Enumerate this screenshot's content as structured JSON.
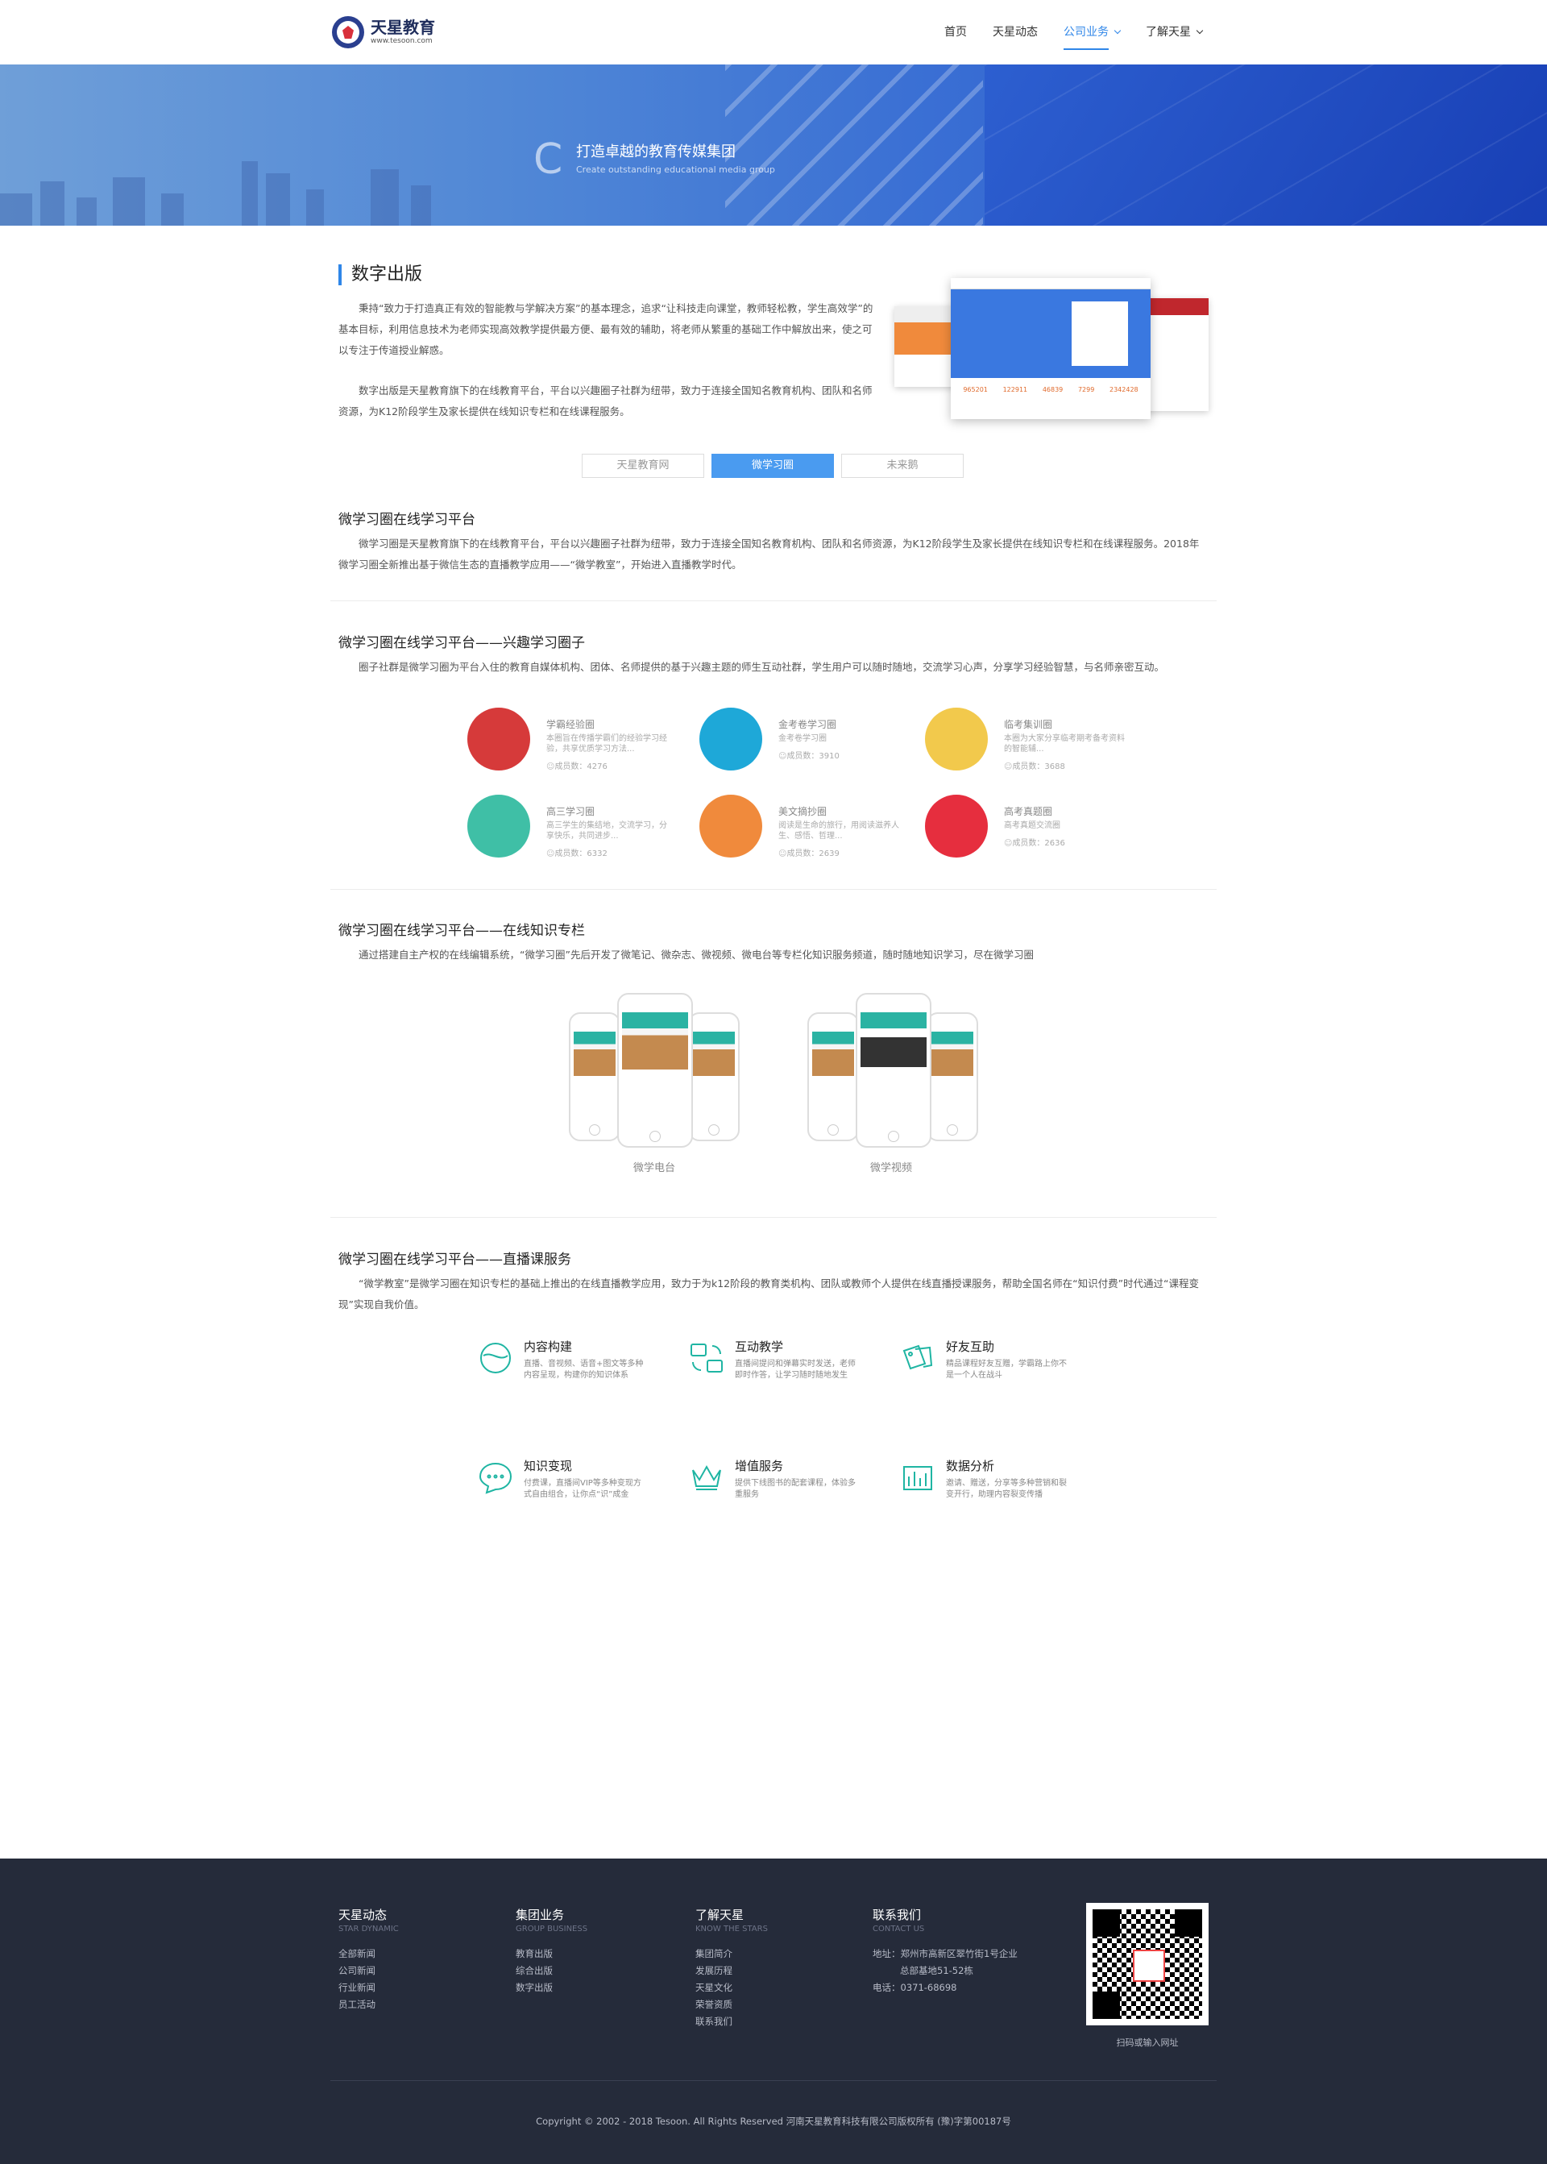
{
  "header": {
    "logo_title": "天星教育",
    "logo_url": "www.tesoon.com",
    "nav": [
      {
        "label": "首页"
      },
      {
        "label": "天星动态"
      },
      {
        "label": "公司业务"
      },
      {
        "label": "了解天星"
      }
    ]
  },
  "banner": {
    "letter": "C",
    "title": "打造卓越的教育传媒集团",
    "subtitle": "Create outstanding educational media group"
  },
  "intro": {
    "heading": "数字出版",
    "para1": "秉持“致力于打造真正有效的智能教与学解决方案”的基本理念，追求“让科技走向课堂，教师轻松教，学生高效学”的基本目标，利用信息技术为老师实现高效教学提供最方便、最有效的辅助，将老师从繁重的基础工作中解放出来，使之可以专注于传道授业解惑。",
    "para2": "数字出版是天星教育旗下的在线教育平台，平台以兴趣圈子社群为纽带，致力于连接全国知名教育机构、团队和名师资源，为K12阶段学生及家长提供在线知识专栏和在线课程服务。",
    "screen_numbers": [
      "965201",
      "122911",
      "46839",
      "7299",
      "2342428"
    ]
  },
  "tabs": [
    {
      "label": "天星教育网"
    },
    {
      "label": "微学习圈"
    },
    {
      "label": "未来鹅"
    }
  ],
  "s1": {
    "title": "微学习圈在线学习平台",
    "text": "微学习圈是天星教育旗下的在线教育平台，平台以兴趣圈子社群为纽带，致力于连接全国知名教育机构、团队和名师资源，为K12阶段学生及家长提供在线知识专栏和在线课程服务。2018年微学习圈全新推出基于微信生态的直播教学应用——“微学教室”，开始进入直播教学时代。"
  },
  "s2": {
    "title": "微学习圈在线学习平台——兴趣学习圈子",
    "text": "圈子社群是微学习圈为平台入住的教育自媒体机构、团体、名师提供的基于兴趣主题的师生互动社群，学生用户可以随时随地，交流学习心声，分享学习经验智慧，与名师亲密互动。",
    "circles": [
      {
        "name": "学霸经验圈",
        "desc": "本圈旨在传播学霸们的经验学习经验，共享优质学习方法...",
        "count": "成员数：4276",
        "color": "#d63a3a"
      },
      {
        "name": "金考卷学习圈",
        "desc": "金考卷学习圈",
        "count": "成员数：3910",
        "color": "#1ea8d8"
      },
      {
        "name": "临考集训圈",
        "desc": "本圈为大家分享临考期考备考资料的智能辅...",
        "count": "成员数：3688",
        "color": "#f2c94c"
      },
      {
        "name": "高三学习圈",
        "desc": "高三学生的集结地，交流学习，分享快乐，共同进步...",
        "count": "成员数：6332",
        "color": "#3fbfa6"
      },
      {
        "name": "美文摘抄圈",
        "desc": "阅读是生命的旅行，用阅读滋养人生、感悟、哲理...",
        "count": "成员数：2639",
        "color": "#f08a3c"
      },
      {
        "name": "高考真题圈",
        "desc": "高考真题交流圈",
        "count": "成员数：2636",
        "color": "#e62e3e"
      }
    ]
  },
  "s3": {
    "title": "微学习圈在线学习平台——在线知识专栏",
    "text": "通过搭建自主产权的在线编辑系统，“微学习圈”先后开发了微笔记、微杂志、微视频、微电台等专栏化知识服务频道，随时随地知识学习，尽在微学习圈",
    "groups": [
      {
        "caption": "微学电台"
      },
      {
        "caption": "微学视频"
      }
    ]
  },
  "s4": {
    "title": "微学习圈在线学习平台——直播课服务",
    "text": "“微学教室”是微学习圈在知识专栏的基础上推出的在线直播教学应用，致力于为k12阶段的教育类机构、团队或教师个人提供在线直播授课服务，帮助全国名师在“知识付费”时代通过“课程变现”实现自我价值。",
    "features": [
      {
        "title": "内容构建",
        "desc": "直播、音视频、语音+图文等多种内容呈现，构建你的知识体系",
        "icon": "content-icon"
      },
      {
        "title": "互动教学",
        "desc": "直播间提问和弹幕实时发送，老师即时作答，让学习随时随地发生",
        "icon": "interaction-icon"
      },
      {
        "title": "好友互助",
        "desc": "精品课程好友互赠，学霸路上你不是一个人在战斗",
        "icon": "friends-icon"
      },
      {
        "title": "知识变现",
        "desc": "付费课，直播间VIP等多种变现方式自由组合，让你点“识”成金",
        "icon": "monetize-icon"
      },
      {
        "title": "增值服务",
        "desc": "提供下线图书的配套课程，体验多重服务",
        "icon": "crown-icon"
      },
      {
        "title": "数据分析",
        "desc": "邀请、赠送，分享等多种营销和裂变开行，助理内容裂变传播",
        "icon": "chart-icon"
      }
    ],
    "accent": "#1fb5a3"
  },
  "footer": {
    "cols": [
      {
        "title": "天星动态",
        "sub": "STAR DYNAMIC",
        "items": [
          "全部新闻",
          "公司新闻",
          "行业新闻",
          "员工活动"
        ]
      },
      {
        "title": "集团业务",
        "sub": "GROUP BUSINESS",
        "items": [
          "教育出版",
          "综合出版",
          "数字出版"
        ]
      },
      {
        "title": "了解天星",
        "sub": "KNOW THE STARS",
        "items": [
          "集团简介",
          "发展历程",
          "天星文化",
          "荣誉资质",
          "联系我们"
        ]
      },
      {
        "title": "联系我们",
        "sub": "CONTACT US",
        "items": [
          "地址：郑州市高新区翠竹街1号企业",
          "总部基地51-52栋",
          "电话：0371-68698"
        ]
      }
    ],
    "qr_caption": "扫码或输入网址",
    "copyright": "Copyright © 2002 - 2018 Tesoon. All Rights Reserved  河南天星教育科技有限公司版权所有 (豫)字第00187号"
  }
}
